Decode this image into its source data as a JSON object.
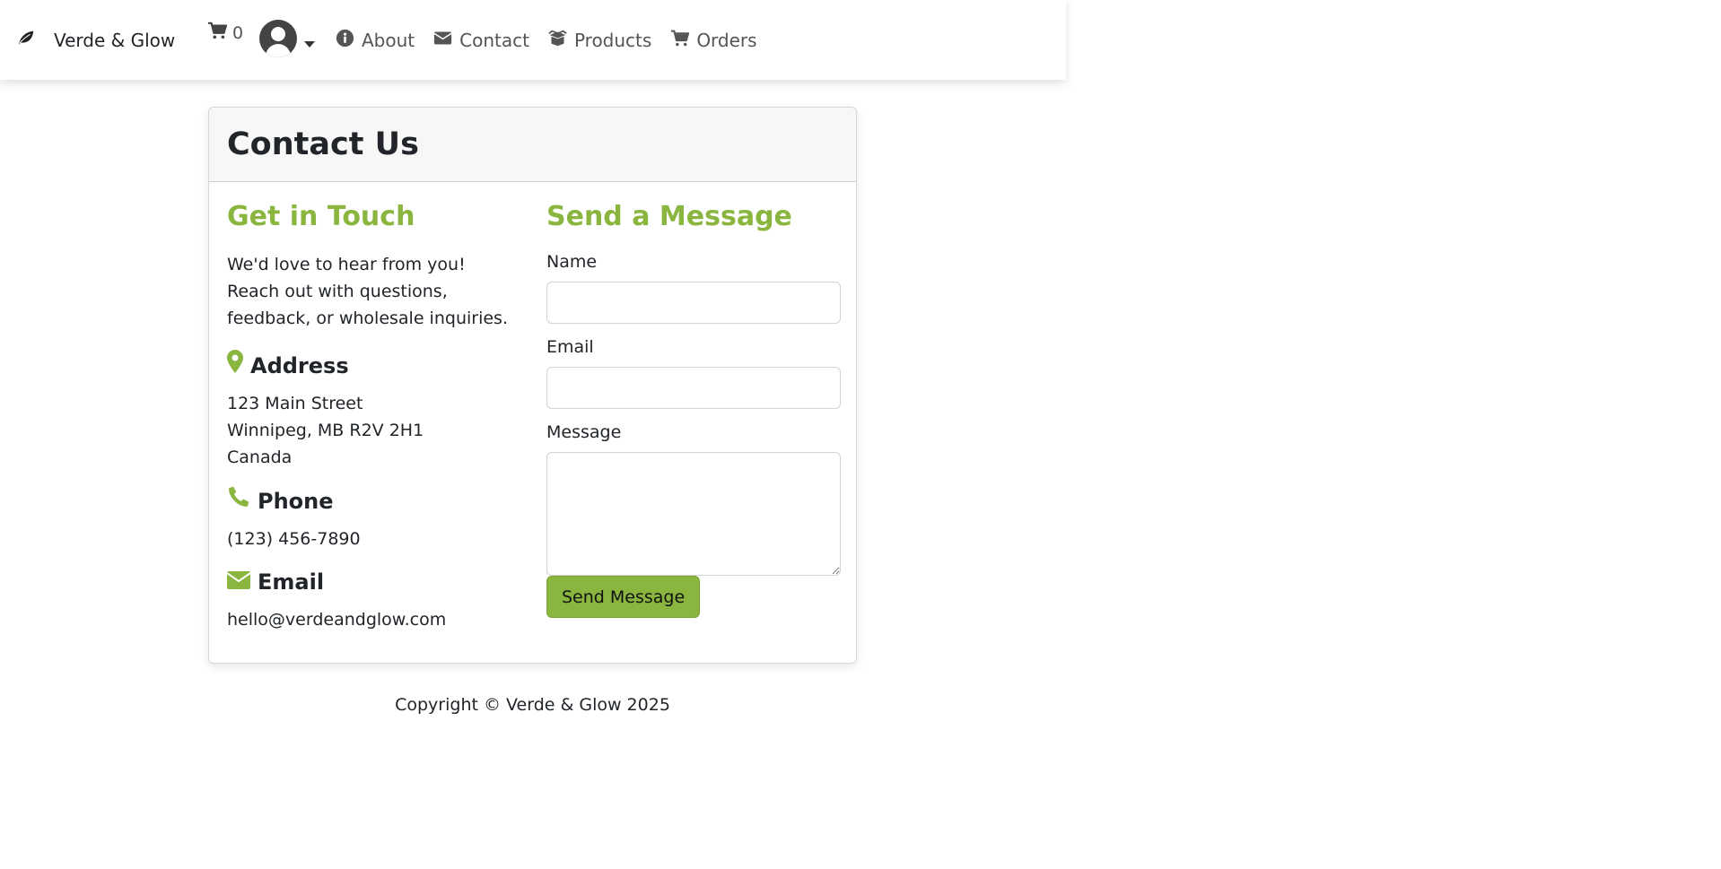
{
  "nav": {
    "brand": {
      "name": "Verde & Glow",
      "icon": "leaf-icon"
    },
    "cart": {
      "icon": "cart-icon",
      "count": "0"
    },
    "user": {
      "icon": "user-circle-icon",
      "menu_icon": "caret-down-icon"
    },
    "links": [
      {
        "label": "About",
        "icon": "info-circle-icon"
      },
      {
        "label": "Contact",
        "icon": "envelope-icon"
      },
      {
        "label": "Products",
        "icon": "box-open-icon"
      },
      {
        "label": "Orders",
        "icon": "shopping-cart-icon"
      }
    ]
  },
  "card": {
    "title": "Contact Us",
    "left": {
      "heading": "Get in Touch",
      "intro": "We'd love to hear from you! Reach out with questions, feedback, or wholesale inquiries.",
      "address": {
        "label": "Address",
        "icon": "map-marker-icon",
        "line1": "123 Main Street",
        "line2": "Winnipeg, MB R2V 2H1",
        "line3": "Canada"
      },
      "phone": {
        "label": "Phone",
        "icon": "phone-icon",
        "value": "(123) 456-7890"
      },
      "email": {
        "label": "Email",
        "icon": "envelope-icon",
        "value": "hello@verdeandglow.com"
      }
    },
    "right": {
      "heading": "Send a Message",
      "name_label": "Name",
      "name_value": "",
      "email_label": "Email",
      "email_value": "",
      "message_label": "Message",
      "message_value": "",
      "submit_label": "Send Message"
    }
  },
  "footer": {
    "text": "Copyright © Verde & Glow 2025"
  },
  "colors": {
    "accent": "#8ab63f",
    "text": "#212529",
    "nav_text": "#555555",
    "header_bg": "#f7f7f7"
  }
}
